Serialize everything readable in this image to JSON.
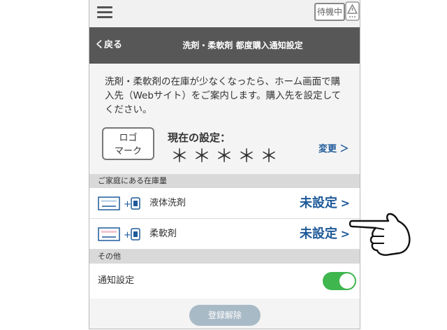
{
  "topbar": {
    "standby_label": "待機中"
  },
  "navbar": {
    "back_label": "く戻る",
    "title": "洗剤・柔軟剤 都度購入通知設定"
  },
  "intro": {
    "text": "洗剤・柔軟剤の在庫が少なくなったら、ホーム画面で購入先（Webサイト）をご案内します。購入先を設定してください。",
    "logo_line1": "ロゴ",
    "logo_line2": "マーク",
    "current_label": "現在の設定：",
    "current_value": "＊＊＊＊＊",
    "change_label": "変更 ＞"
  },
  "inventory": {
    "section_title": "ご家庭にある在庫量",
    "items": [
      {
        "label": "液体洗剤",
        "status": "未設定"
      },
      {
        "label": "柔軟剤",
        "status": "未設定"
      }
    ]
  },
  "other": {
    "section_title": "その他",
    "notify_label": "通知設定",
    "notify_on": true
  },
  "footer": {
    "unregister_label": "登録解除"
  },
  "colors": {
    "accent": "#1e5a99",
    "toggle_on": "#3fb64e",
    "navbar": "#575757"
  }
}
